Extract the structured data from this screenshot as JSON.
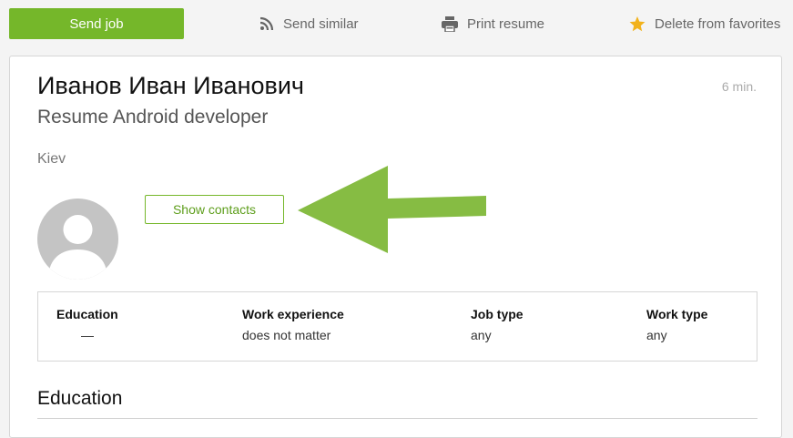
{
  "toolbar": {
    "send_job_label": "Send job",
    "send_similar_label": "Send similar",
    "print_resume_label": "Print resume",
    "delete_favorites_label": "Delete from favorites"
  },
  "resume": {
    "name": "Иванов Иван Иванович",
    "title": "Resume Android developer",
    "time_ago": "6 min.",
    "city": "Kiev",
    "show_contacts_label": "Show contacts"
  },
  "info": {
    "education": {
      "label": "Education",
      "value": "—"
    },
    "work_experience": {
      "label": "Work experience",
      "value": "does not matter"
    },
    "job_type": {
      "label": "Job type",
      "value": "any"
    },
    "work_type": {
      "label": "Work type",
      "value": "any"
    }
  },
  "sections": {
    "education_title": "Education"
  },
  "colors": {
    "accent": "#75b72a",
    "arrow": "#86bc43",
    "star": "#f2b21b",
    "muted_icon": "#666666"
  }
}
